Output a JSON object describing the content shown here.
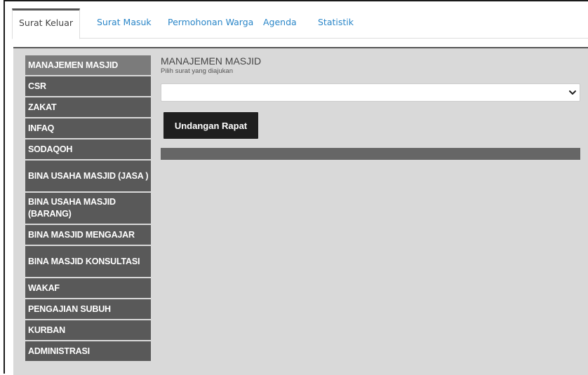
{
  "tabs": [
    {
      "label": "Surat Keluar",
      "active": true
    },
    {
      "label": "Surat Masuk",
      "active": false
    },
    {
      "label": "Permohonan Warga",
      "active": false
    },
    {
      "label": "Agenda",
      "active": false
    },
    {
      "label": "Statistik",
      "active": false
    }
  ],
  "sidebar": {
    "items": [
      {
        "label": "MANAJEMEN MASJID",
        "active": true
      },
      {
        "label": "CSR"
      },
      {
        "label": "ZAKAT"
      },
      {
        "label": "INFAQ"
      },
      {
        "label": "SODAQOH"
      },
      {
        "label": "BINA USAHA MASJID (JASA )"
      },
      {
        "label": "BINA USAHA MASJID (BARANG)"
      },
      {
        "label": "BINA MASJID MENGAJAR"
      },
      {
        "label": "BINA MASJID KONSULTASI"
      },
      {
        "label": "WAKAF"
      },
      {
        "label": "PENGAJIAN SUBUH"
      },
      {
        "label": "KURBAN"
      },
      {
        "label": "ADMINISTRASI"
      }
    ]
  },
  "main": {
    "title": "MANAJEMEN MASJID",
    "subtitle": "Pilih surat yang diajukan",
    "select_value": "",
    "button_label": "Undangan Rapat"
  },
  "icons": {
    "select_chevron": "chevron-down-icon"
  },
  "colors": {
    "tab_link": "#2a86c8",
    "menu_bg": "#595959",
    "menu_active_bg": "#7b7b7b",
    "panel_bg": "#d9d9d9",
    "button_bg": "#1f1f1f"
  }
}
